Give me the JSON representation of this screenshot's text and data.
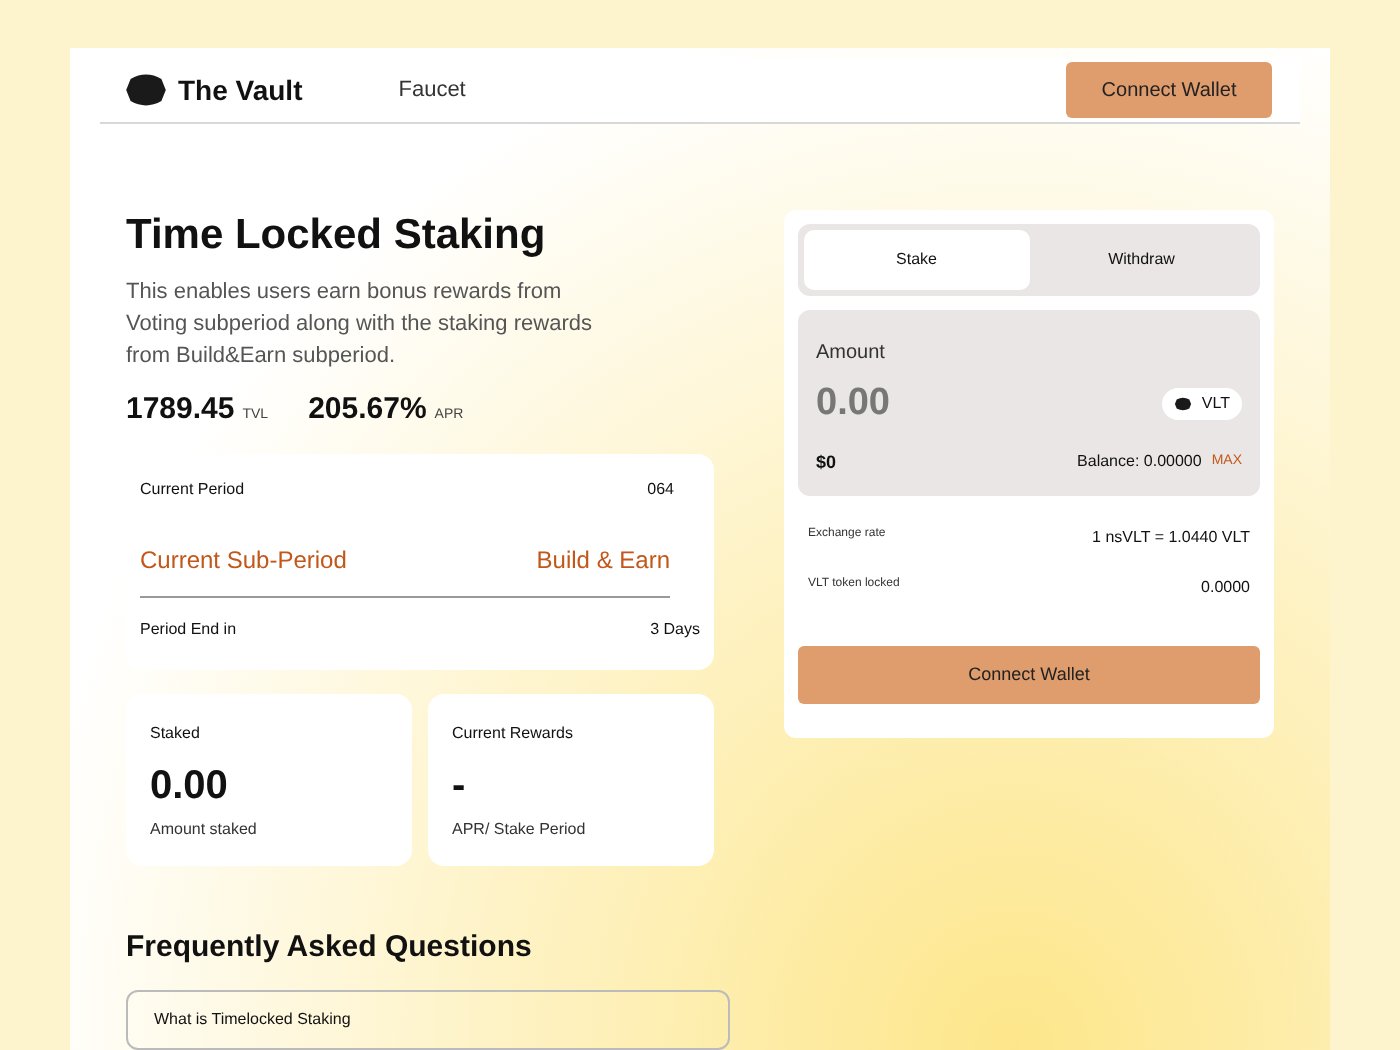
{
  "header": {
    "brand": "The Vault",
    "nav": [
      "Faucet"
    ],
    "button": "Connect Wallet"
  },
  "hero": {
    "title": "Time Locked Staking",
    "description": "This enables users earn bonus rewards from Voting subperiod along with the staking rewards from Build&Earn subperiod.",
    "stats": [
      {
        "value": "1789.45",
        "unit": "TVL"
      },
      {
        "value": "205.67%",
        "unit": "APR"
      }
    ]
  },
  "period": {
    "current_label": "Current Period",
    "current_value": "064",
    "sub_label": "Current Sub-Period",
    "sub_value": "Build & Earn",
    "end_label": "Period End in",
    "end_value": "3 Days"
  },
  "cards": [
    {
      "title": "Staked",
      "value": "0.00",
      "caption": "Amount staked"
    },
    {
      "title": "Current Rewards",
      "value": "-",
      "caption": "APR/ Stake Period"
    }
  ],
  "faq": {
    "title": "Frequently Asked Questions",
    "items": [
      "What is Timelocked Staking"
    ]
  },
  "panel": {
    "tabs": [
      {
        "label": "Stake",
        "selected": true
      },
      {
        "label": "Withdraw",
        "selected": false
      }
    ],
    "amount_label": "Amount",
    "amount_placeholder": "0.00",
    "token": "VLT",
    "usd": "$0",
    "balance": "Balance: 0.00000",
    "max": "MAX",
    "rows": [
      {
        "label": "Exchange rate",
        "value": "1 nsVLT = 1.0440 VLT"
      },
      {
        "label": "VLT token locked",
        "value": "0.0000"
      }
    ],
    "button": "Connect Wallet"
  }
}
